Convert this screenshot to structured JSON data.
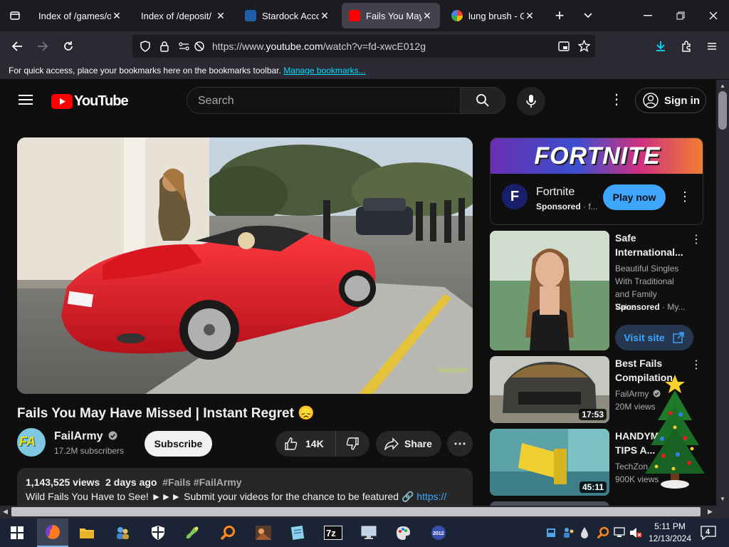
{
  "browser": {
    "tabs": [
      {
        "label": "Index of /games/oth",
        "active": false
      },
      {
        "label": "Index of /deposit/",
        "active": false
      },
      {
        "label": "Stardock Account",
        "active": false
      },
      {
        "label": "Fails You May Have",
        "active": true
      },
      {
        "label": "lung brush - Google",
        "active": false
      }
    ],
    "url_prefix": "https://www.",
    "url_domain": "youtube.com",
    "url_path": "/watch?v=fd-xwcE012g",
    "bookmarks_text": "For quick access, place your bookmarks here on the bookmarks toolbar.",
    "bookmarks_link": "Manage bookmarks..."
  },
  "youtube": {
    "logo": "YouTube",
    "search_placeholder": "Search",
    "sign_in": "Sign in",
    "video": {
      "title": "Fails You May Have Missed | Instant Regret 😞",
      "channel": "FailArmy",
      "channel_initials": "FA",
      "subscribers": "17.2M subscribers",
      "subscribe_label": "Subscribe",
      "likes": "14K",
      "share_label": "Share",
      "views": "1,143,525 views",
      "age": "2 days ago",
      "tags": "#Fails #FailArmy",
      "desc_line": "Wild Fails You Have to See! ►►► Submit your videos for the chance to be featured 🔗",
      "desc_link": "https://",
      "player_watermark": "FAILARMY"
    },
    "ad": {
      "banner_text": "FORTNITE",
      "name": "Fortnite",
      "initial": "F",
      "sponsored": "Sponsored",
      "sponsored_suffix": "· f...",
      "cta": "Play now"
    },
    "recommendations": [
      {
        "title": "Safe International...",
        "sub1": "Beautiful Singles With Traditional and Family Value...",
        "sub2": "Sponsored",
        "sub2_suffix": "· My...",
        "cta": "Visit site",
        "duration": ""
      },
      {
        "title": "Best Fails Compilation",
        "sub1": "FailArmy",
        "sub2": "20M views",
        "duration": "17:53"
      },
      {
        "title": "HANDYMAN TIPS A...",
        "sub1": "TechZon...",
        "sub2": "900K views",
        "duration": "45:11"
      }
    ]
  },
  "taskbar": {
    "time": "5:11 PM",
    "date": "12/13/2024",
    "notifications": "4"
  },
  "colors": {
    "youtube_red": "#ff0000",
    "yt_bg": "#0f0f0f",
    "play_now_blue": "#3ea6ff",
    "firefox_chrome": "#1c1b22",
    "ferrari_red": "#e0202a"
  }
}
